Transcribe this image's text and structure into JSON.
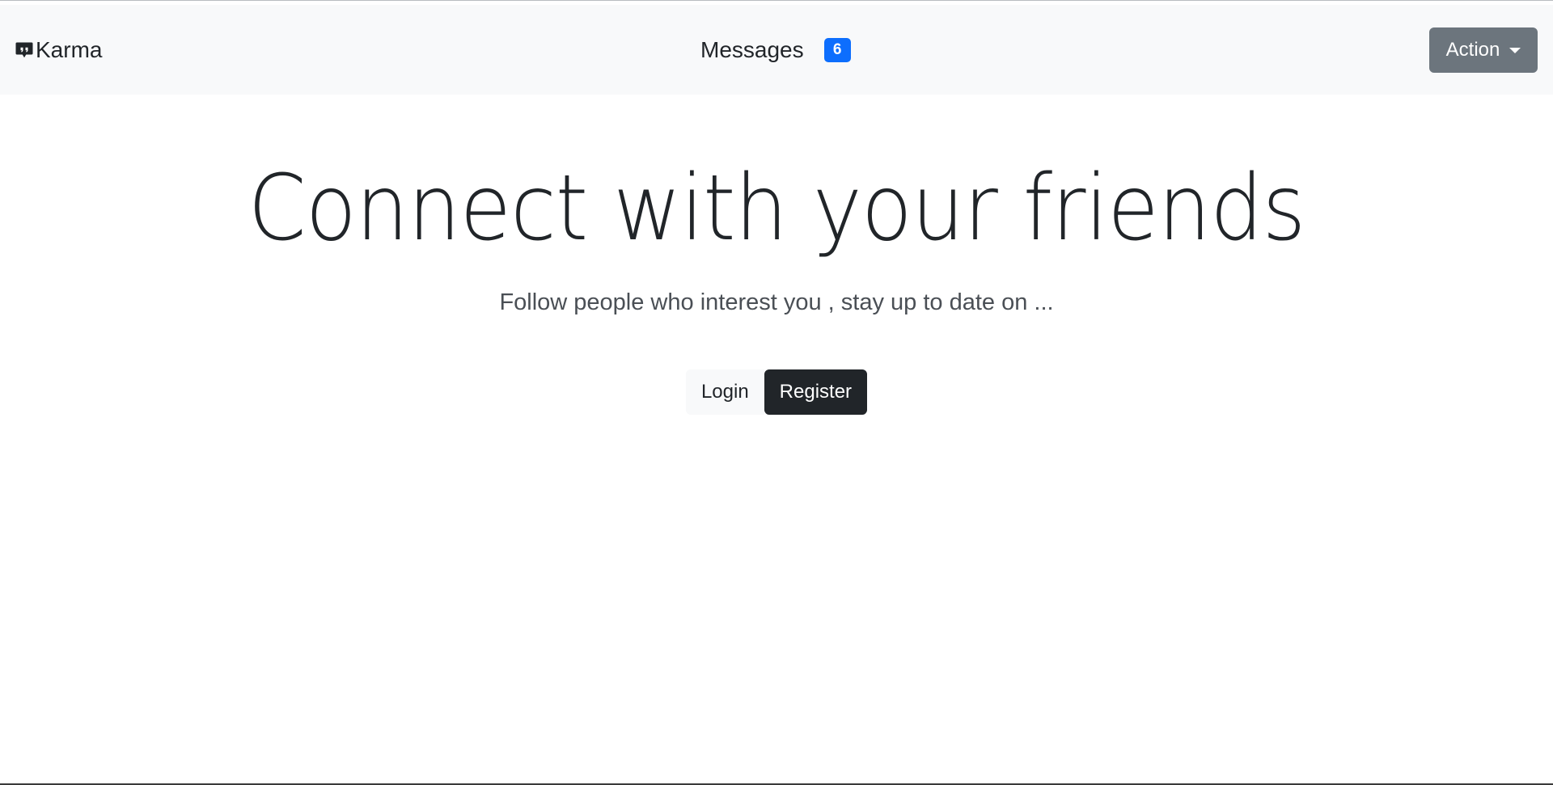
{
  "navbar": {
    "brand": {
      "icon": "chat-quote-icon",
      "label": "Karma"
    },
    "messages": {
      "label": "Messages",
      "count": "6"
    },
    "action": {
      "label": "Action",
      "icon": "caret-down-icon"
    }
  },
  "hero": {
    "title": "Connect with your friends",
    "subtitle": "Follow people who interest you , stay up to date on ...",
    "login_label": "Login",
    "register_label": "Register"
  },
  "colors": {
    "navbar_bg": "#f8f9fa",
    "badge": "#0d6efd",
    "action_btn": "#6c757d",
    "register_btn": "#212529"
  }
}
